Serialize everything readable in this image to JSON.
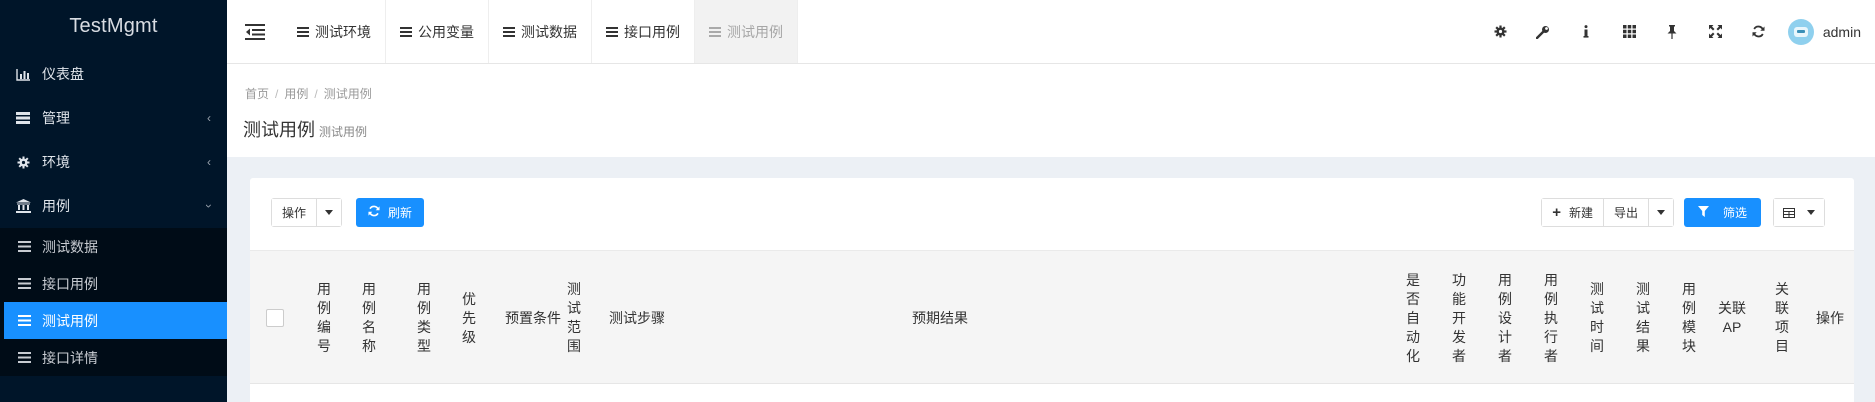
{
  "app": {
    "brand": "TestMgmt"
  },
  "sidebar": {
    "items": [
      {
        "label": "仪表盘",
        "icon": "bar-chart-icon"
      },
      {
        "label": "管理",
        "icon": "list-icon",
        "expanded": false
      },
      {
        "label": "环境",
        "icon": "gear-icon",
        "expanded": false
      },
      {
        "label": "用例",
        "icon": "bank-icon",
        "expanded": true
      }
    ],
    "subitems": [
      {
        "label": "测试数据",
        "active": false
      },
      {
        "label": "接口用例",
        "active": false
      },
      {
        "label": "测试用例",
        "active": true
      },
      {
        "label": "接口详情",
        "active": false
      }
    ]
  },
  "topbar": {
    "tabs": [
      {
        "label": "测试环境"
      },
      {
        "label": "公用变量"
      },
      {
        "label": "测试数据"
      },
      {
        "label": "接口用例"
      },
      {
        "label": "测试用例",
        "current": true
      }
    ],
    "tools": [
      "gear-icon",
      "wrench-icon",
      "info-icon",
      "grid-icon",
      "pin-icon",
      "fullscreen-icon",
      "refresh-icon"
    ],
    "user": "admin"
  },
  "breadcrumb": [
    "首页",
    "用例",
    "测试用例"
  ],
  "page": {
    "title": "测试用例",
    "subtitle": "测试用例"
  },
  "toolbar": {
    "operate": "操作",
    "refresh": "刷新",
    "new": "新建",
    "export": "导出",
    "filter": "筛选"
  },
  "table": {
    "columns": [
      "用例编号",
      "用例名称",
      "用例类型",
      "优先级",
      "预置条件",
      "测试范围",
      "测试步骤",
      "预期结果",
      "是否自动化",
      "功能开发者",
      "用例设计者",
      "用例执行者",
      "测试时间",
      "测试结果",
      "用例模块",
      "关联AP",
      "关联项目",
      "操作"
    ]
  },
  "colors": {
    "accent": "#1890ff",
    "sidebar": "#001529"
  }
}
